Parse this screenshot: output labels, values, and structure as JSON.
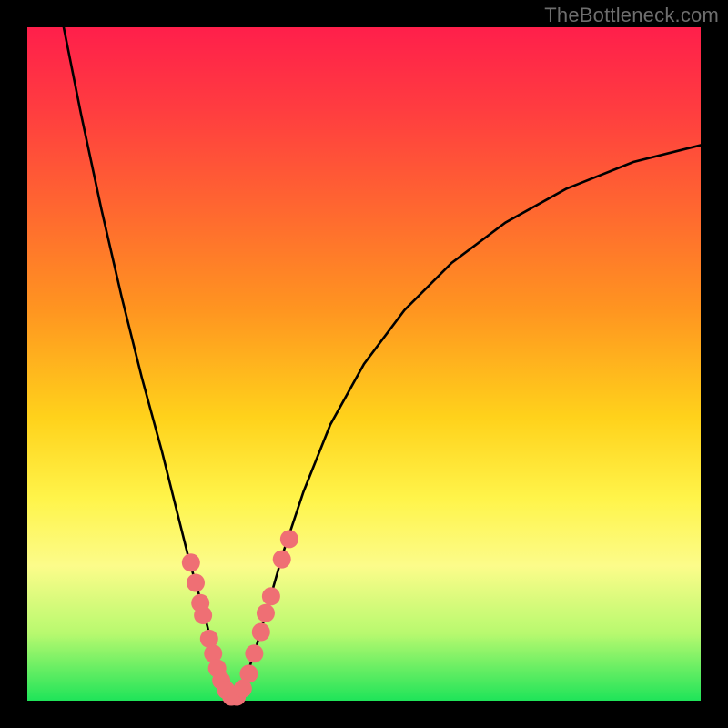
{
  "watermark": "TheBottleneck.com",
  "chart_data": {
    "type": "line",
    "title": "",
    "xlabel": "",
    "ylabel": "",
    "xlim": [
      0,
      100
    ],
    "ylim": [
      0,
      100
    ],
    "series": [
      {
        "name": "bottleneck-curve",
        "x": [
          5.4,
          8,
          11,
          14,
          17,
          20,
          22,
          24,
          26,
          27.5,
          29,
          30.3,
          32,
          34,
          36,
          38,
          41,
          45,
          50,
          56,
          63,
          71,
          80,
          90,
          100
        ],
        "y": [
          100,
          87,
          73,
          60,
          48,
          37,
          29,
          21,
          14,
          8,
          3,
          0.5,
          2,
          8,
          15,
          22,
          31,
          41,
          50,
          58,
          65,
          71,
          76,
          80,
          82.5
        ]
      }
    ],
    "scatter": [
      {
        "name": "sample-points",
        "points": [
          {
            "x": 24.3,
            "y": 20.5
          },
          {
            "x": 25.0,
            "y": 17.5
          },
          {
            "x": 25.7,
            "y": 14.5
          },
          {
            "x": 26.1,
            "y": 12.7
          },
          {
            "x": 27.0,
            "y": 9.2
          },
          {
            "x": 27.6,
            "y": 7.0
          },
          {
            "x": 28.2,
            "y": 4.8
          },
          {
            "x": 28.8,
            "y": 3.0
          },
          {
            "x": 29.5,
            "y": 1.6
          },
          {
            "x": 30.3,
            "y": 0.6
          },
          {
            "x": 31.1,
            "y": 0.6
          },
          {
            "x": 32.0,
            "y": 1.8
          },
          {
            "x": 32.9,
            "y": 4.0
          },
          {
            "x": 33.7,
            "y": 7.0
          },
          {
            "x": 34.7,
            "y": 10.2
          },
          {
            "x": 35.4,
            "y": 13.0
          },
          {
            "x": 36.2,
            "y": 15.5
          },
          {
            "x": 37.8,
            "y": 21.0
          },
          {
            "x": 38.9,
            "y": 24.0
          }
        ]
      }
    ]
  }
}
